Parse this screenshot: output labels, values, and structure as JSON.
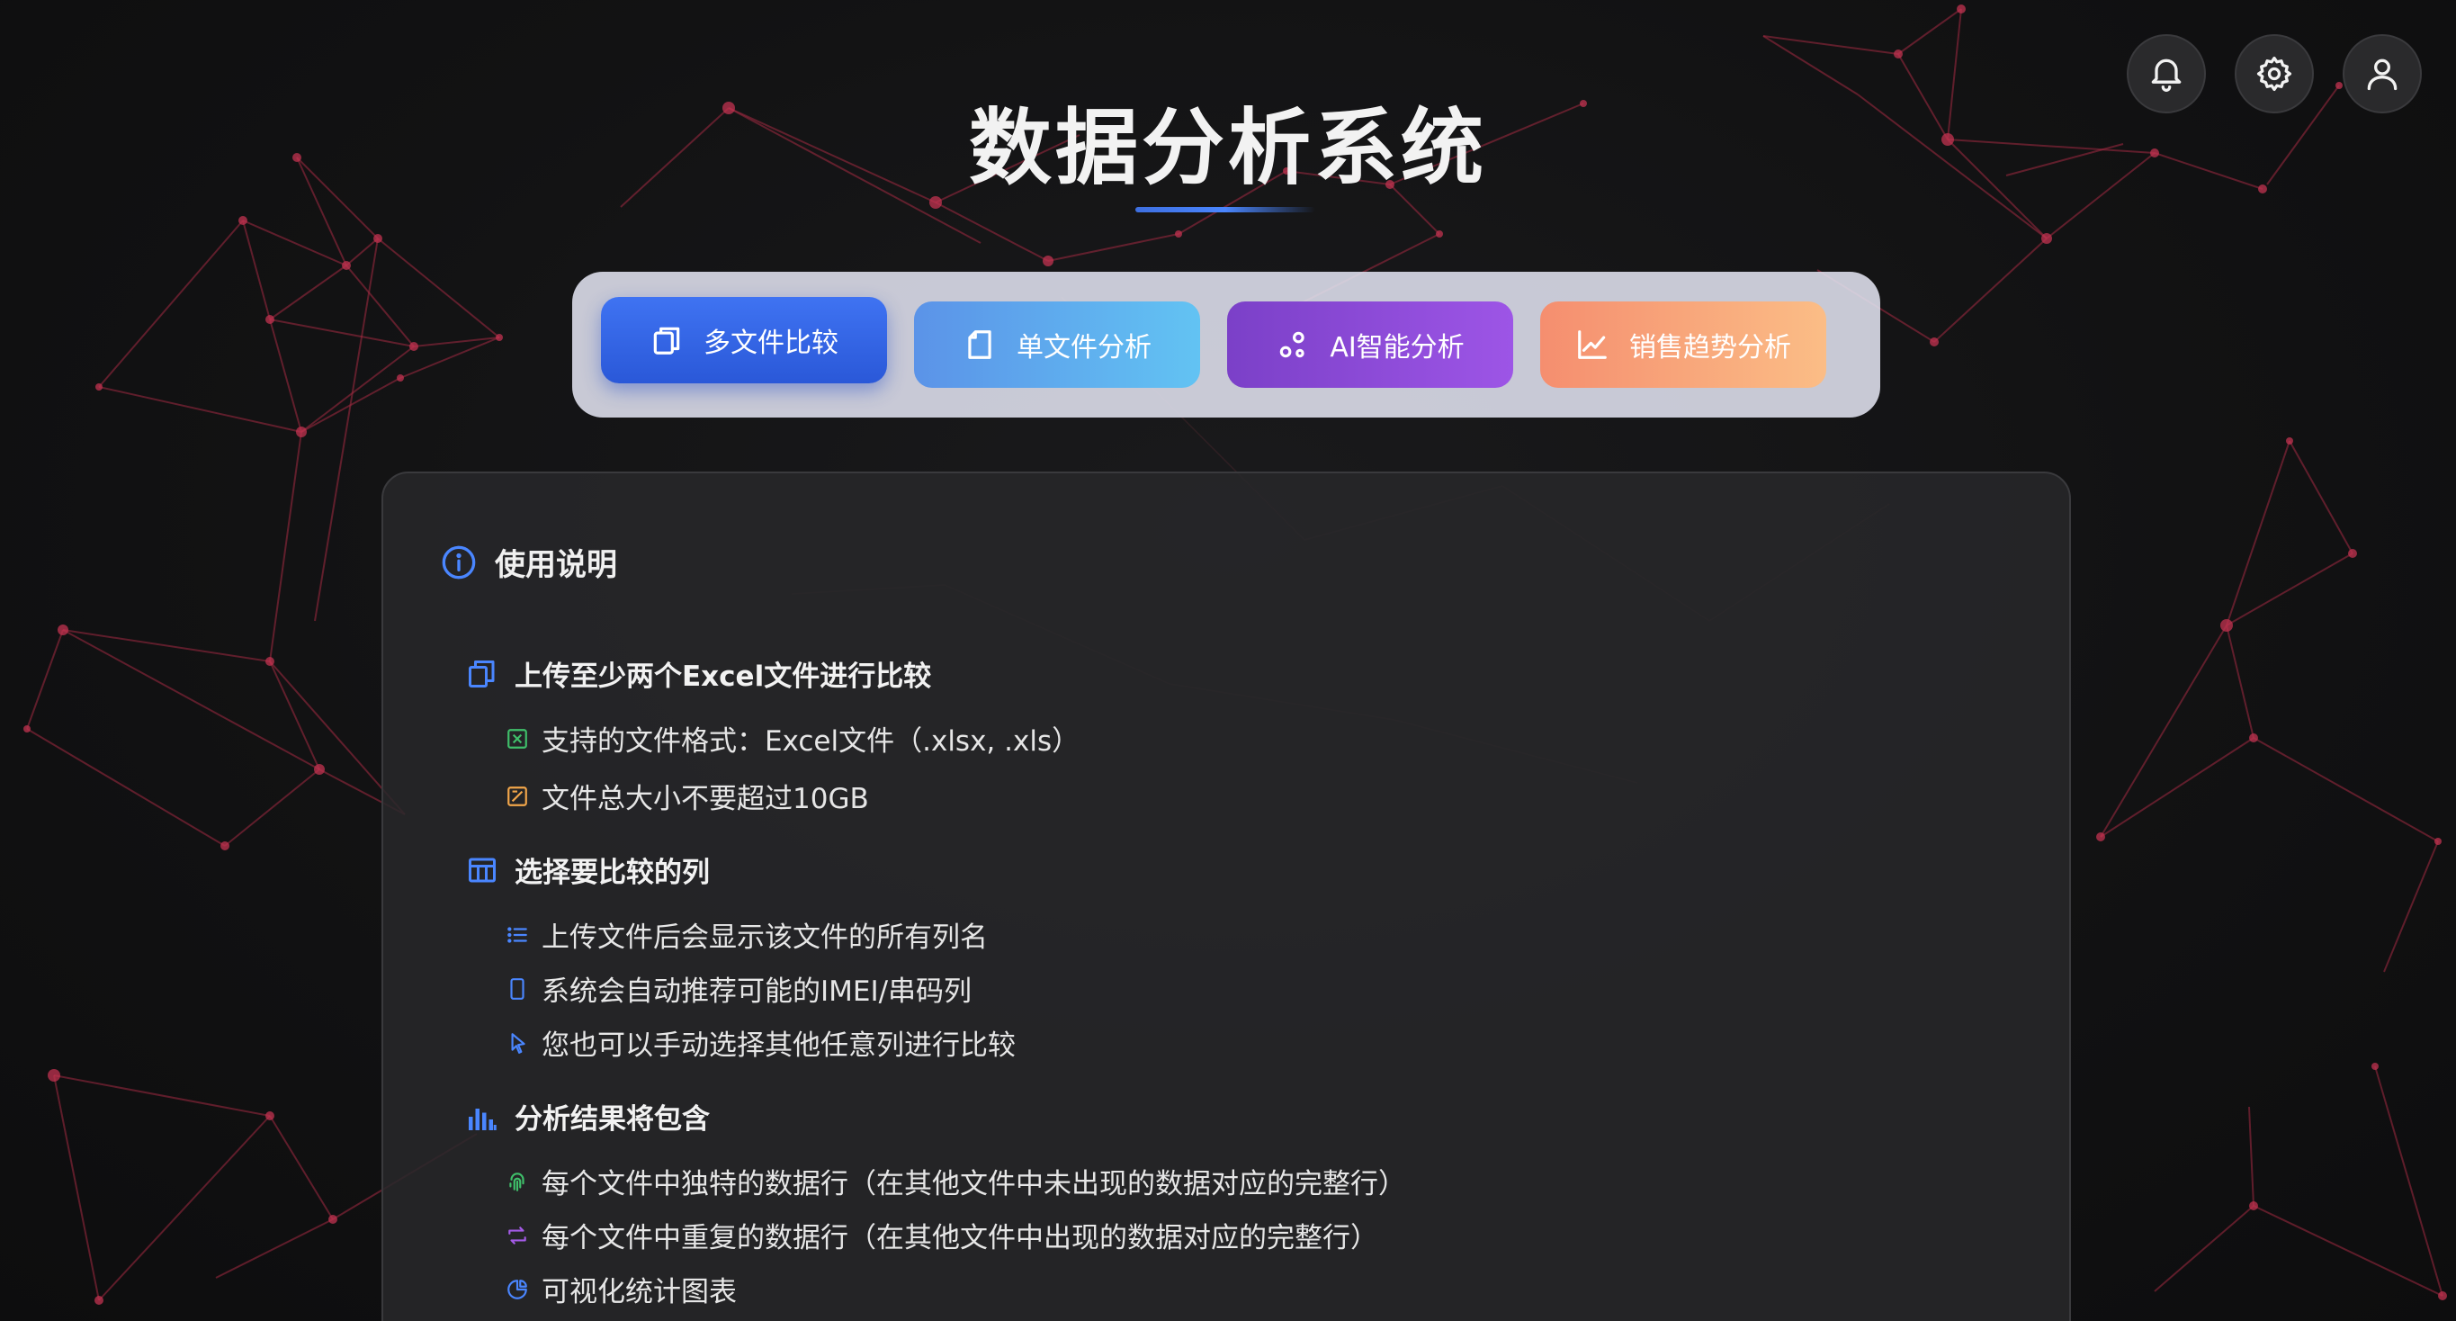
{
  "app": {
    "title": "数据分析系统"
  },
  "header_actions": [
    {
      "name": "notifications",
      "icon": "bell-icon"
    },
    {
      "name": "settings",
      "icon": "gear-icon"
    },
    {
      "name": "user",
      "icon": "user-icon"
    }
  ],
  "tabs": [
    {
      "label": "多文件比较",
      "icon": "copy-icon",
      "active": true
    },
    {
      "label": "单文件分析",
      "icon": "file-icon",
      "active": false
    },
    {
      "label": "AI智能分析",
      "icon": "ai-nodes-icon",
      "active": false
    },
    {
      "label": "销售趋势分析",
      "icon": "line-chart-icon",
      "active": false
    }
  ],
  "instructions": {
    "title": "使用说明",
    "sections": [
      {
        "heading": "上传至少两个Excel文件进行比较",
        "icon": "copy-icon",
        "items": [
          {
            "text": "支持的文件格式：Excel文件（.xlsx, .xls）",
            "icon": "excel-file-icon"
          },
          {
            "text": "文件总大小不要超过10GB",
            "icon": "file-size-icon"
          }
        ]
      },
      {
        "heading": "选择要比较的列",
        "icon": "table-icon",
        "items": [
          {
            "text": "上传文件后会显示该文件的所有列名",
            "icon": "list-icon"
          },
          {
            "text": "系统会自动推荐可能的IMEI/串码列",
            "icon": "mobile-icon"
          },
          {
            "text": "您也可以手动选择其他任意列进行比较",
            "icon": "pointer-icon"
          }
        ]
      },
      {
        "heading": "分析结果将包含",
        "icon": "bar-chart-icon",
        "items": [
          {
            "text": "每个文件中独特的数据行（在其他文件中未出现的数据对应的完整行）",
            "icon": "fingerprint-icon"
          },
          {
            "text": "每个文件中重复的数据行（在其他文件中出现的数据对应的完整行）",
            "icon": "repeat-icon"
          },
          {
            "text": "可视化统计图表",
            "icon": "pie-chart-icon"
          }
        ]
      }
    ]
  },
  "colors": {
    "accent_blue": "#3f73f2",
    "network_line": "#b0304a",
    "card_bg": "#28282a"
  }
}
